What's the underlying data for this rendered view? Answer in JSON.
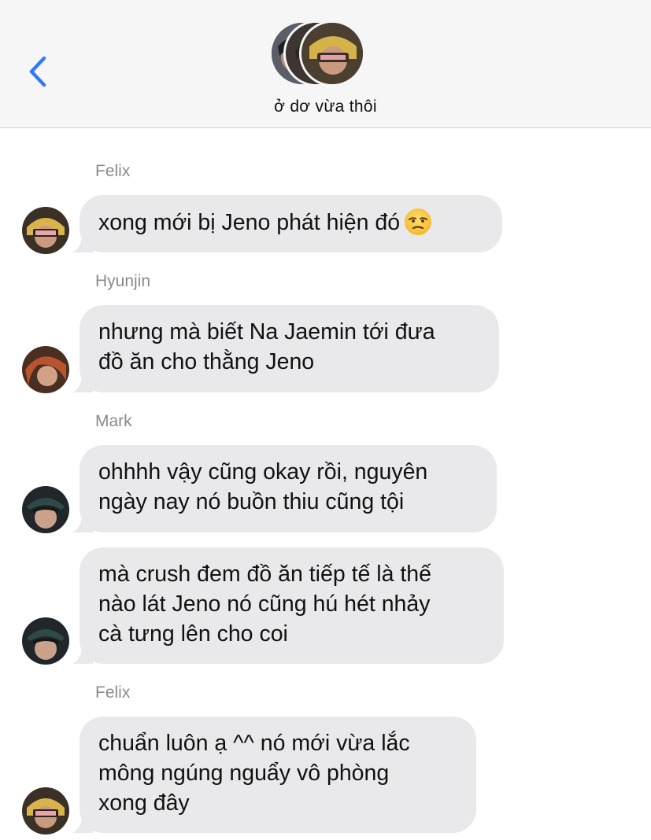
{
  "header": {
    "back_icon": "chevron-left-icon",
    "group_name": "ở dơ vừa thôi"
  },
  "colors": {
    "accent": "#3478f6",
    "bubble": "#e9e9eb",
    "header_bg": "#f6f6f6",
    "sender_text": "#8a8a8e"
  },
  "messages": [
    {
      "sender": "Felix",
      "text": "xong mới bị Jeno phát hiện đó",
      "emoji": "unamused-face-icon"
    },
    {
      "sender": "Hyunjin",
      "text": "nhưng mà biết Na Jaemin tới đưa\nđồ ăn cho thằng Jeno"
    },
    {
      "sender": "Mark",
      "text": "ohhhh vậy cũng okay rồi, nguyên\nngày nay nó buồn thiu cũng tội"
    },
    {
      "sender": "Mark",
      "text": "mà crush đem đồ ăn tiếp tế là thế\nnào lát Jeno nó cũng hú hét nhảy\ncà tưng lên cho coi"
    },
    {
      "sender": "Felix",
      "text": "chuẩn luôn ạ ^^ nó mới vừa lắc\nmông ngúng nguẩy vô phòng\nxong đây"
    }
  ]
}
